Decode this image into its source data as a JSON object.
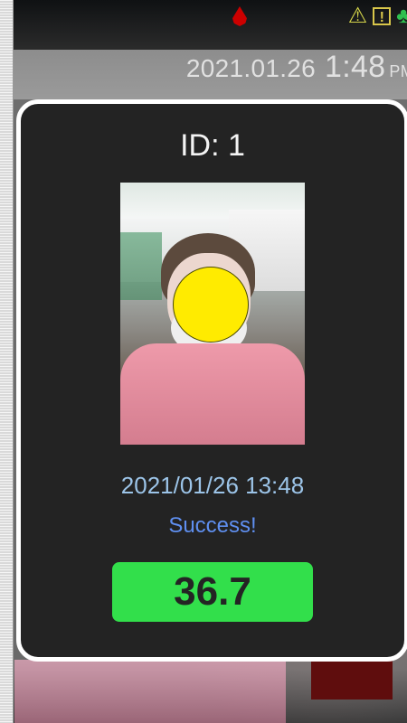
{
  "status_bar": {
    "icons": [
      "blood-drop-icon",
      "warning-icon",
      "alert-icon",
      "leaf-icon"
    ],
    "date": "2021.01.26",
    "time": "1:48",
    "ampm": "PM"
  },
  "modal": {
    "id_label": "ID: 1",
    "capture_time": "2021/01/26 13:48",
    "status_message": "Success!",
    "temperature": "36.7"
  },
  "colors": {
    "modal_background": "#232323",
    "modal_border": "#ffffff",
    "status_success": "#5f8ff0",
    "temperature_badge": "#32df4b",
    "capture_time_color": "#9cc4e8",
    "face_redaction": "#ffeb00"
  }
}
